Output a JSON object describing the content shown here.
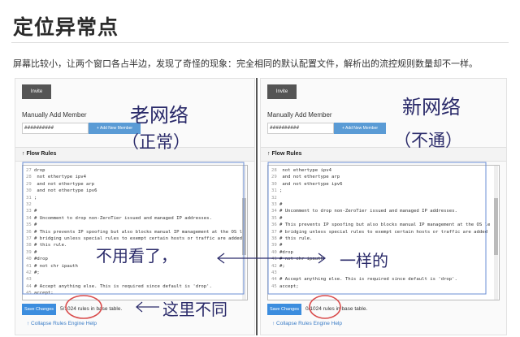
{
  "slide": {
    "title": "定位异常点",
    "subtitle": "屏幕比较小，让两个窗口各占半边，发现了奇怪的现象：完全相同的默认配置文件，解析出的流控规则数量却不一样。"
  },
  "panels": [
    {
      "invite_label": "Invite",
      "manual_label": "Manually Add Member",
      "id_value": "##########",
      "add_label": "+ Add New Member",
      "flow_header": "↑ Flow Rules",
      "code_lines": [
        {
          "n": "27",
          "t": "drop"
        },
        {
          "n": "28",
          "t": "  not ethertype ipv4"
        },
        {
          "n": "29",
          "t": "  and not ethertype arp"
        },
        {
          "n": "30",
          "t": "  and not ethertype ipv6"
        },
        {
          "n": "31",
          "t": ";"
        },
        {
          "n": "32",
          "t": ""
        },
        {
          "n": "33",
          "t": "#"
        },
        {
          "n": "34",
          "t": "# Uncomment to drop non-ZeroTier issued and managed IP addresses."
        },
        {
          "n": "35",
          "t": "#"
        },
        {
          "n": "36",
          "t": "# This prevents IP spoofing but also blocks manual IP management at the OS le"
        },
        {
          "n": "37",
          "t": "# bridging unless special rules to exempt certain hosts or traffic are added"
        },
        {
          "n": "38",
          "t": "# this rule."
        },
        {
          "n": "39",
          "t": "#"
        },
        {
          "n": "40",
          "t": "#drop"
        },
        {
          "n": "41",
          "t": "#  not chr ipauth"
        },
        {
          "n": "42",
          "t": "#;"
        },
        {
          "n": "43",
          "t": ""
        },
        {
          "n": "44",
          "t": "# Accept anything else. This is required since default is 'drop'."
        },
        {
          "n": "45",
          "t": "accept;"
        }
      ],
      "save_label": "Save Changes",
      "rules_count": "5/1024 rules in base table.",
      "collapse_label": "↑ Collapse Rules Engine Help"
    },
    {
      "invite_label": "Invite",
      "manual_label": "Manually Add Member",
      "id_value": "##########",
      "add_label": "+ Add New Member",
      "flow_header": "↑ Flow Rules",
      "code_lines": [
        {
          "n": "28",
          "t": "  not ethertype ipv4"
        },
        {
          "n": "29",
          "t": "  and not ethertype arp"
        },
        {
          "n": "30",
          "t": "  and not ethertype ipv6"
        },
        {
          "n": "31",
          "t": ";"
        },
        {
          "n": "32",
          "t": ""
        },
        {
          "n": "33",
          "t": "#"
        },
        {
          "n": "34",
          "t": "# Uncomment to drop non-ZeroTier issued and managed IP addresses."
        },
        {
          "n": "35",
          "t": "#"
        },
        {
          "n": "36",
          "t": "# This prevents IP spoofing but also blocks manual IP management at the OS le"
        },
        {
          "n": "37",
          "t": "# bridging unless special rules to exempt certain hosts or traffic are added"
        },
        {
          "n": "38",
          "t": "# this rule."
        },
        {
          "n": "39",
          "t": "#"
        },
        {
          "n": "40",
          "t": "#drop"
        },
        {
          "n": "41",
          "t": "#  not chr ipauth"
        },
        {
          "n": "42",
          "t": "#;"
        },
        {
          "n": "43",
          "t": ""
        },
        {
          "n": "44",
          "t": "# Accept anything else. This is required since default is 'drop'."
        },
        {
          "n": "45",
          "t": "accept;"
        }
      ],
      "save_label": "Save Changes",
      "rules_count": "0/1024 rules in base table.",
      "collapse_label": "↑ Collapse Rules Engine Help"
    }
  ],
  "annotations": {
    "left_title": "老网络",
    "left_paren": "（正常）",
    "right_title": "新网络",
    "right_paren": "（不通）",
    "middle_left": "不用看了，",
    "middle_right": "一样的",
    "bottom": "这里不同",
    "ink_color": "#2b2b6a",
    "circle_color": "#d94b4b",
    "box_color": "#6b8fd6"
  }
}
